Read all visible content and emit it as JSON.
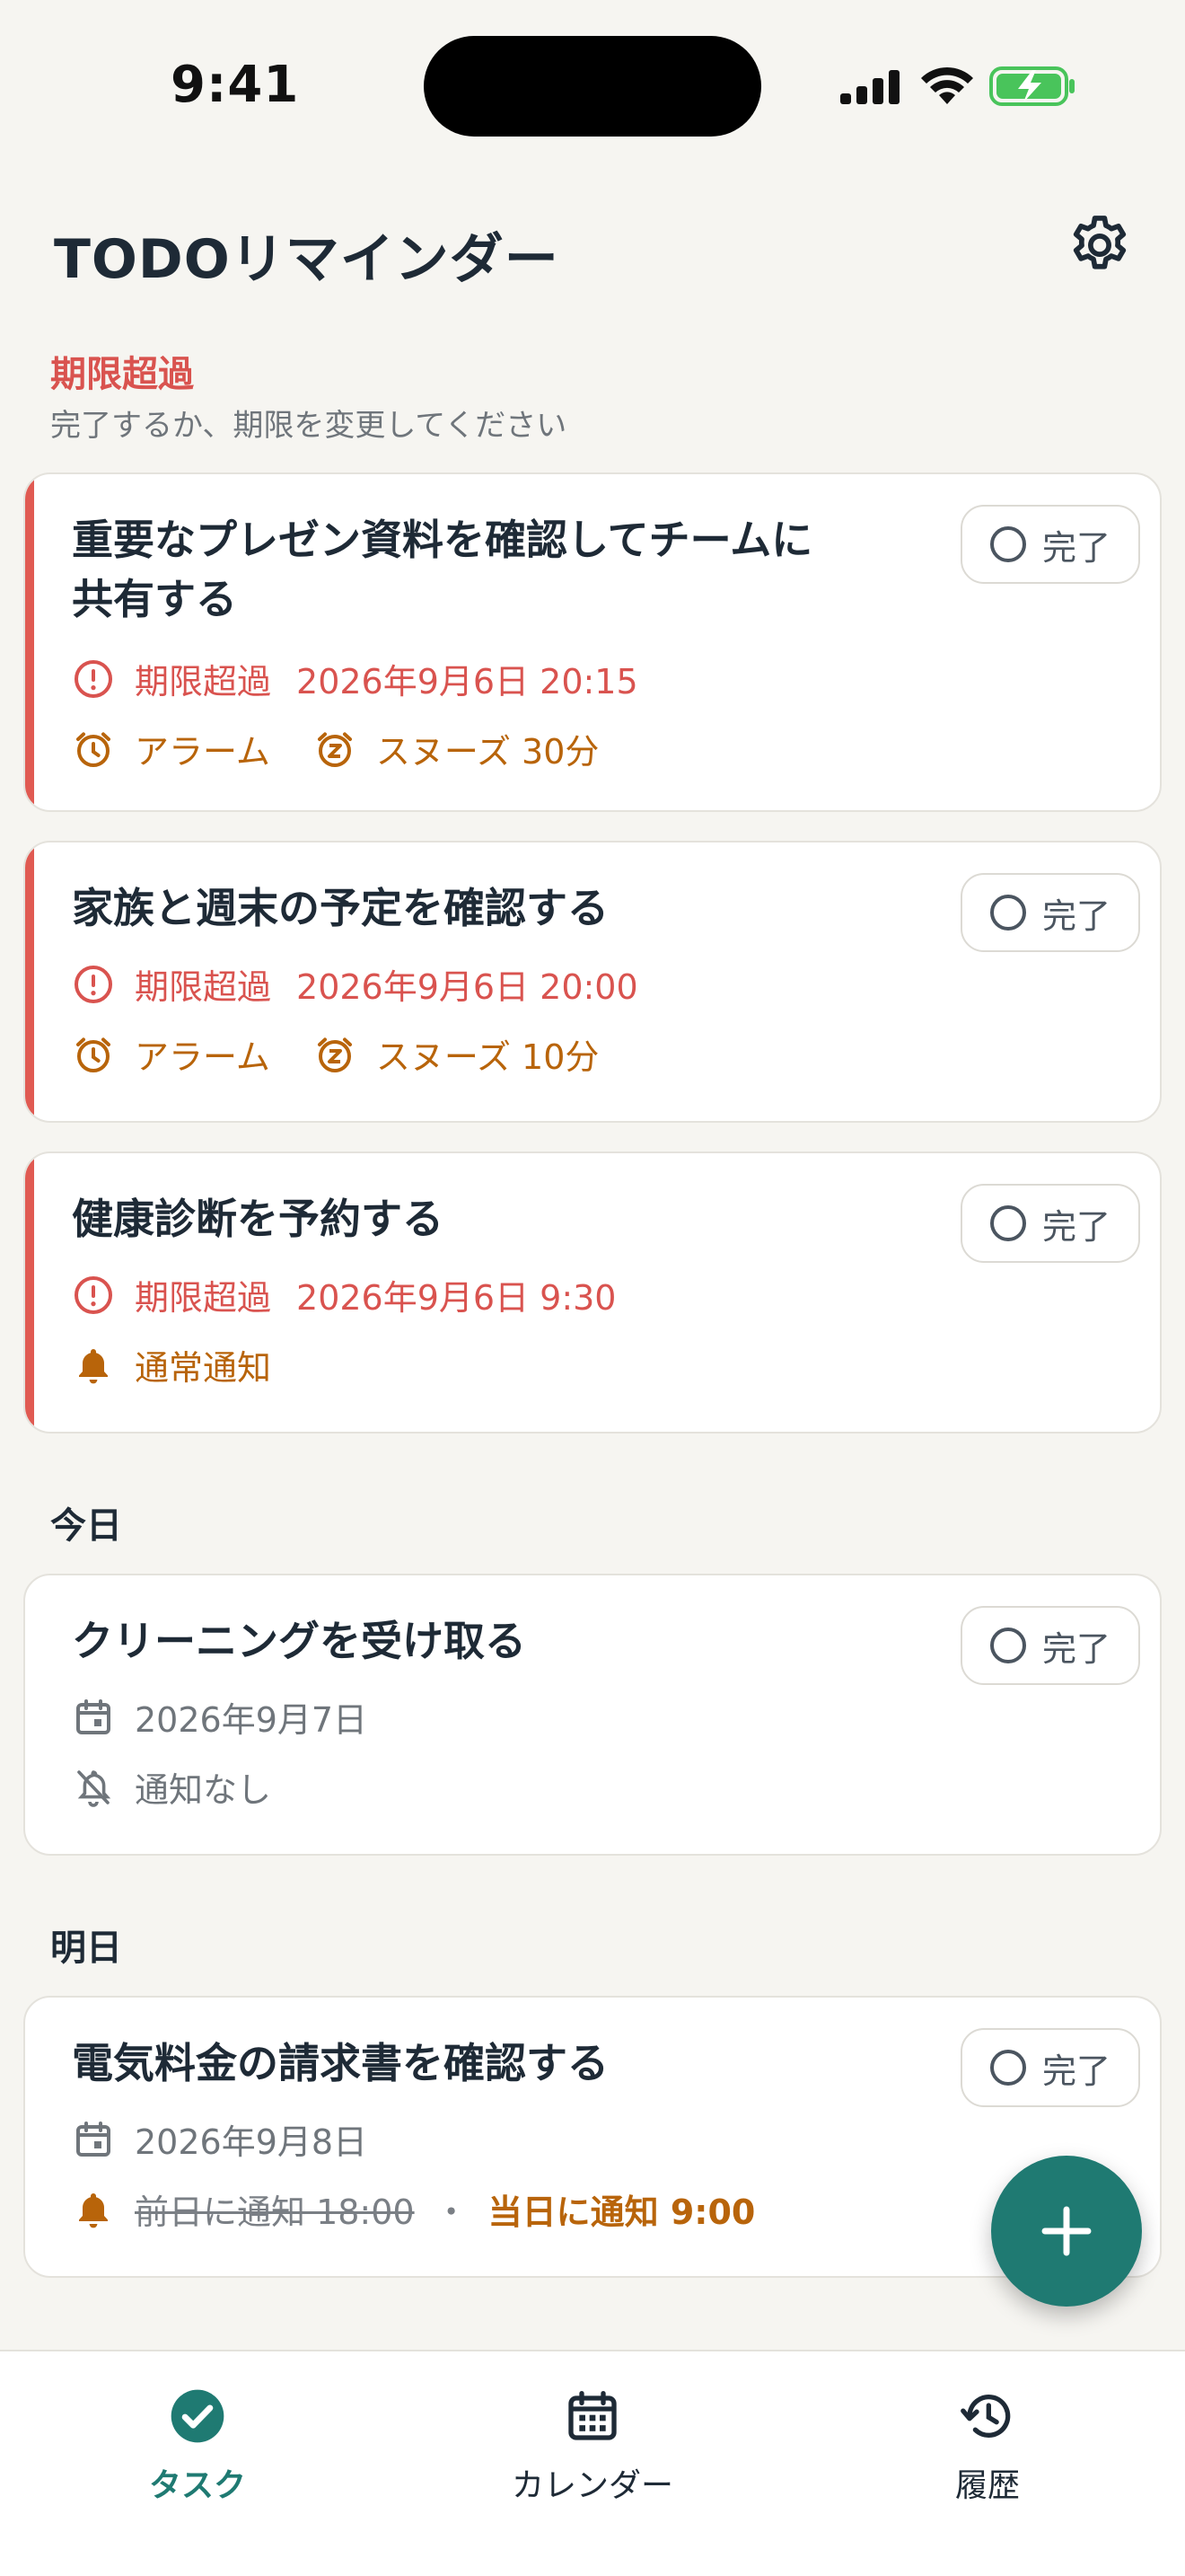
{
  "status_bar": {
    "time": "9:41"
  },
  "header": {
    "title": "TODOリマインダー"
  },
  "sections": {
    "overdue": {
      "title": "期限超過",
      "subtitle": "完了するか、期限を変更してください"
    },
    "today": {
      "title": "今日"
    },
    "tomorrow": {
      "title": "明日"
    }
  },
  "done_label": "完了",
  "tasks": [
    {
      "title": "重要なプレゼン資料を確認してチームに共有する",
      "status": "期限超過",
      "due": "2026年9月6日 20:15",
      "alert": "アラーム",
      "snooze": "スヌーズ 30分"
    },
    {
      "title": "家族と週末の予定を確認する",
      "status": "期限超過",
      "due": "2026年9月6日 20:00",
      "alert": "アラーム",
      "snooze": "スヌーズ 10分"
    },
    {
      "title": "健康診断を予約する",
      "status": "期限超過",
      "due": "2026年9月6日 9:30",
      "alert": "通常通知"
    },
    {
      "title": "クリーニングを受け取る",
      "date": "2026年9月7日",
      "alert": "通知なし"
    },
    {
      "title": "電気料金の請求書を確認する",
      "date": "2026年9月8日",
      "alert_old": "前日に通知 18:00",
      "separator": "・",
      "alert_new": "当日に通知 9:00"
    }
  ],
  "tabs": [
    {
      "label": "タスク",
      "icon": "check-circle-icon",
      "active": true
    },
    {
      "label": "カレンダー",
      "icon": "calendar-icon",
      "active": false
    },
    {
      "label": "履歴",
      "icon": "history-icon",
      "active": false
    }
  ],
  "colors": {
    "accent": "#1f7a72",
    "overdue": "#d9534f",
    "alert": "#b8640a",
    "background": "#f6f5f1"
  }
}
